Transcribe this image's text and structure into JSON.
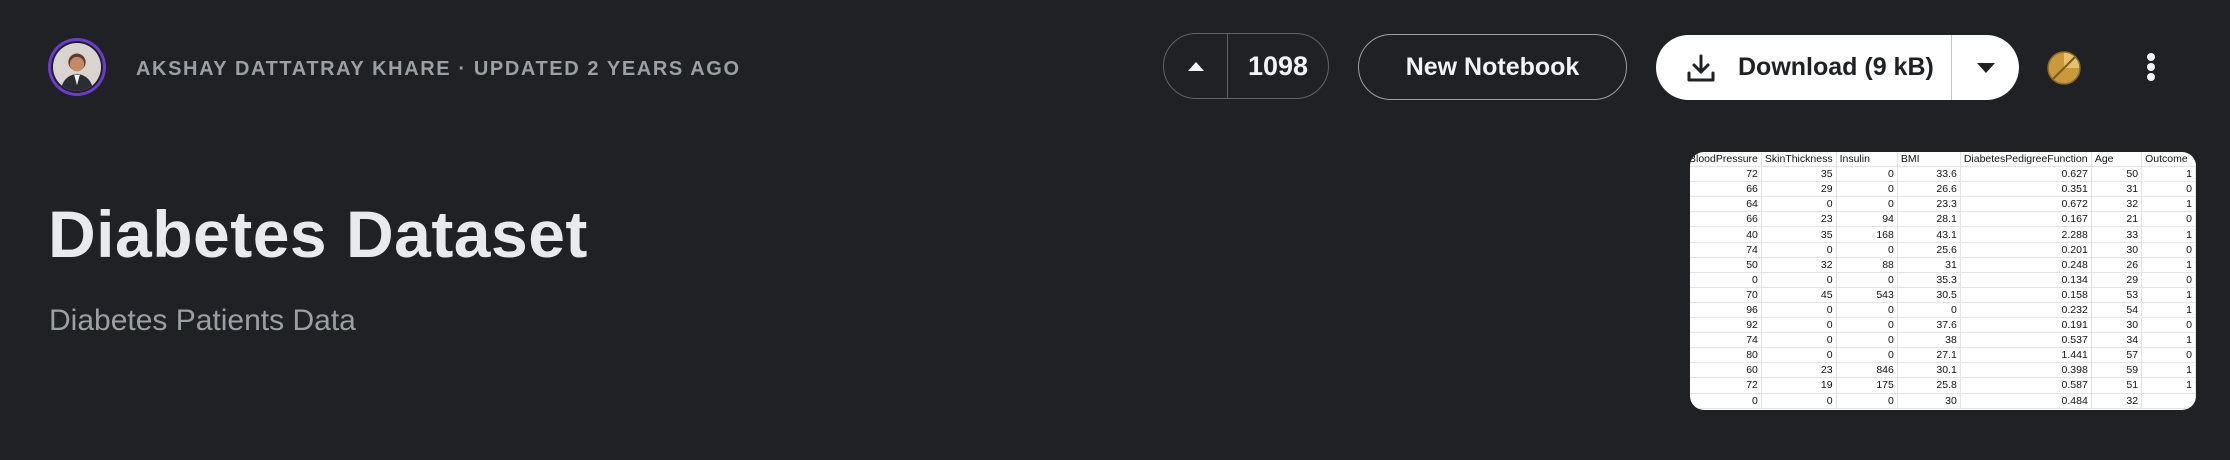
{
  "header": {
    "author": "AKSHAY DATTATRAY KHARE",
    "separator": "·",
    "updated": "UPDATED 2 YEARS AGO",
    "upvote_count": "1098",
    "new_notebook_label": "New Notebook",
    "download_label": "Download (9 kB)",
    "icons": {
      "avatar": "user-avatar",
      "upvote": "caret-up-icon",
      "download": "download-icon",
      "dropdown": "chevron-down-icon",
      "medal": "bronze-medal-icon",
      "more": "more-vertical-icon"
    }
  },
  "dataset": {
    "title": "Diabetes Dataset",
    "subtitle": "Diabetes Patients Data"
  },
  "preview": {
    "columns": [
      "BloodPressure",
      "SkinThickness",
      "Insulin",
      "BMI",
      "DiabetesPedigreeFunction",
      "Age",
      "Outcome"
    ],
    "rows": [
      [
        "72",
        "35",
        "0",
        "33.6",
        "0.627",
        "50",
        "1"
      ],
      [
        "66",
        "29",
        "0",
        "26.6",
        "0.351",
        "31",
        "0"
      ],
      [
        "64",
        "0",
        "0",
        "23.3",
        "0.672",
        "32",
        "1"
      ],
      [
        "66",
        "23",
        "94",
        "28.1",
        "0.167",
        "21",
        "0"
      ],
      [
        "40",
        "35",
        "168",
        "43.1",
        "2.288",
        "33",
        "1"
      ],
      [
        "74",
        "0",
        "0",
        "25.6",
        "0.201",
        "30",
        "0"
      ],
      [
        "50",
        "32",
        "88",
        "31",
        "0.248",
        "26",
        "1"
      ],
      [
        "0",
        "0",
        "0",
        "35.3",
        "0.134",
        "29",
        "0"
      ],
      [
        "70",
        "45",
        "543",
        "30.5",
        "0.158",
        "53",
        "1"
      ],
      [
        "96",
        "0",
        "0",
        "0",
        "0.232",
        "54",
        "1"
      ],
      [
        "92",
        "0",
        "0",
        "37.6",
        "0.191",
        "30",
        "0"
      ],
      [
        "74",
        "0",
        "0",
        "38",
        "0.537",
        "34",
        "1"
      ],
      [
        "80",
        "0",
        "0",
        "27.1",
        "1.441",
        "57",
        "0"
      ],
      [
        "60",
        "23",
        "846",
        "30.1",
        "0.398",
        "59",
        "1"
      ],
      [
        "72",
        "19",
        "175",
        "25.8",
        "0.587",
        "51",
        "1"
      ],
      [
        "0",
        "0",
        "0",
        "30",
        "0.484",
        "32",
        ""
      ]
    ]
  },
  "colors": {
    "background": "#202124",
    "avatar_ring": "#6c3bd1",
    "medal": "#c99a3b"
  }
}
